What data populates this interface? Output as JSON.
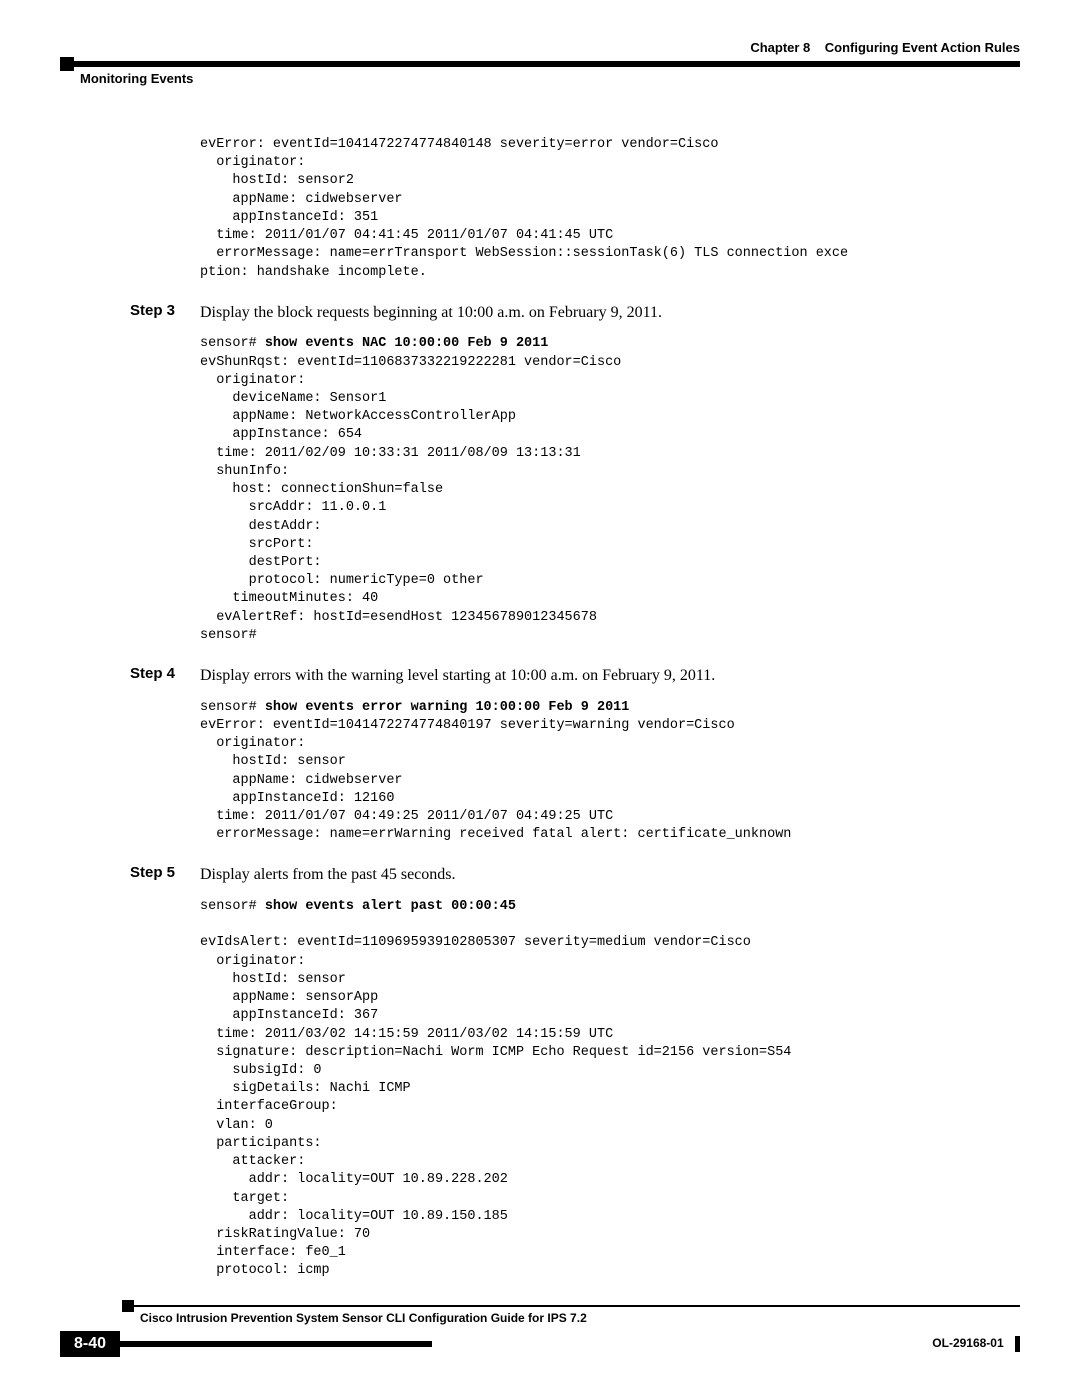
{
  "header": {
    "chapter": "Chapter 8",
    "title": "Configuring Event Action Rules",
    "section": "Monitoring Events"
  },
  "codeBlock1": "evError: eventId=1041472274774840148 severity=error vendor=Cisco\n  originator:\n    hostId: sensor2\n    appName: cidwebserver\n    appInstanceId: 351\n  time: 2011/01/07 04:41:45 2011/01/07 04:41:45 UTC\n  errorMessage: name=errTransport WebSession::sessionTask(6) TLS connection exce\nption: handshake incomplete.",
  "step3": {
    "label": "Step 3",
    "text": "Display the block requests beginning at 10:00 a.m. on February 9, 2011.",
    "prompt": "sensor# ",
    "cmd": "show events NAC 10:00:00 Feb 9 2011",
    "output": "evShunRqst: eventId=1106837332219222281 vendor=Cisco\n  originator:\n    deviceName: Sensor1\n    appName: NetworkAccessControllerApp\n    appInstance: 654\n  time: 2011/02/09 10:33:31 2011/08/09 13:13:31\n  shunInfo:\n    host: connectionShun=false\n      srcAddr: 11.0.0.1\n      destAddr:\n      srcPort:\n      destPort:\n      protocol: numericType=0 other\n    timeoutMinutes: 40\n  evAlertRef: hostId=esendHost 123456789012345678\nsensor#"
  },
  "step4": {
    "label": "Step 4",
    "text": "Display errors with the warning level starting at 10:00 a.m. on February 9, 2011.",
    "prompt": "sensor# ",
    "cmd": "show events error warning 10:00:00 Feb 9 2011",
    "output": "evError: eventId=1041472274774840197 severity=warning vendor=Cisco\n  originator:\n    hostId: sensor\n    appName: cidwebserver\n    appInstanceId: 12160\n  time: 2011/01/07 04:49:25 2011/01/07 04:49:25 UTC\n  errorMessage: name=errWarning received fatal alert: certificate_unknown"
  },
  "step5": {
    "label": "Step 5",
    "text": "Display alerts from the past 45 seconds.",
    "prompt": "sensor# ",
    "cmd": "show events alert past 00:00:45",
    "output": "\nevIdsAlert: eventId=1109695939102805307 severity=medium vendor=Cisco\n  originator:\n    hostId: sensor\n    appName: sensorApp\n    appInstanceId: 367\n  time: 2011/03/02 14:15:59 2011/03/02 14:15:59 UTC\n  signature: description=Nachi Worm ICMP Echo Request id=2156 version=S54\n    subsigId: 0\n    sigDetails: Nachi ICMP\n  interfaceGroup:\n  vlan: 0\n  participants:\n    attacker:\n      addr: locality=OUT 10.89.228.202\n    target:\n      addr: locality=OUT 10.89.150.185\n  riskRatingValue: 70\n  interface: fe0_1\n  protocol: icmp"
  },
  "footer": {
    "guide": "Cisco Intrusion Prevention System Sensor CLI Configuration Guide for IPS 7.2",
    "pageNum": "8-40",
    "docId": "OL-29168-01"
  }
}
